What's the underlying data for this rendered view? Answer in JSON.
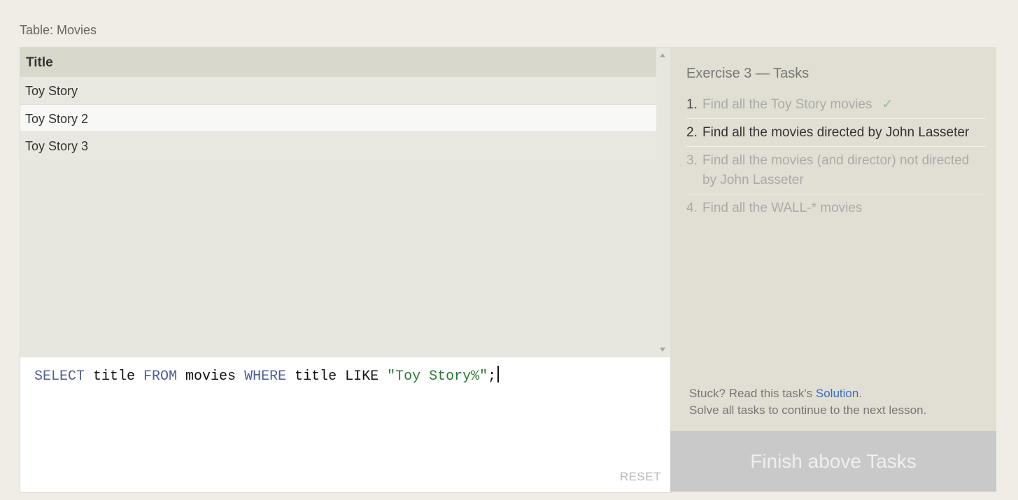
{
  "table_caption": "Table: Movies",
  "results": {
    "columns": [
      "Title"
    ],
    "rows": [
      {
        "title": "Toy Story"
      },
      {
        "title": "Toy Story 2"
      },
      {
        "title": "Toy Story 3"
      }
    ]
  },
  "editor": {
    "tokens": {
      "select": "SELECT",
      "t1": " title ",
      "from": "FROM",
      "t2": " movies ",
      "where": "WHERE",
      "t3": " title LIKE ",
      "str": "\"Toy Story%\"",
      "end": ";"
    },
    "reset_label": "RESET"
  },
  "exercise": {
    "title": "Exercise 3 — Tasks",
    "tasks": [
      {
        "num": "1.",
        "text": "Find all the Toy Story movies",
        "check": "✓"
      },
      {
        "num": "2.",
        "text": "Find all the movies directed by John Lasseter"
      },
      {
        "num": "3.",
        "text": "Find all the movies (and director) not directed by John Lasseter"
      },
      {
        "num": "4.",
        "text": "Find all the WALL-* movies"
      }
    ],
    "stuck_prefix": "Stuck? Read this task's ",
    "solution_link": "Solution",
    "stuck_suffix": ".",
    "solve_all": "Solve all tasks to continue to the next lesson.",
    "finish_button": "Finish above Tasks"
  },
  "colors": {
    "keyword": "#4c5d97",
    "string": "#2a7a32",
    "check": "#88c48a",
    "link": "#3a6cc9"
  },
  "icons": [
    "scroll-up-arrow-icon",
    "scroll-down-arrow-icon",
    "checkmark-icon"
  ]
}
